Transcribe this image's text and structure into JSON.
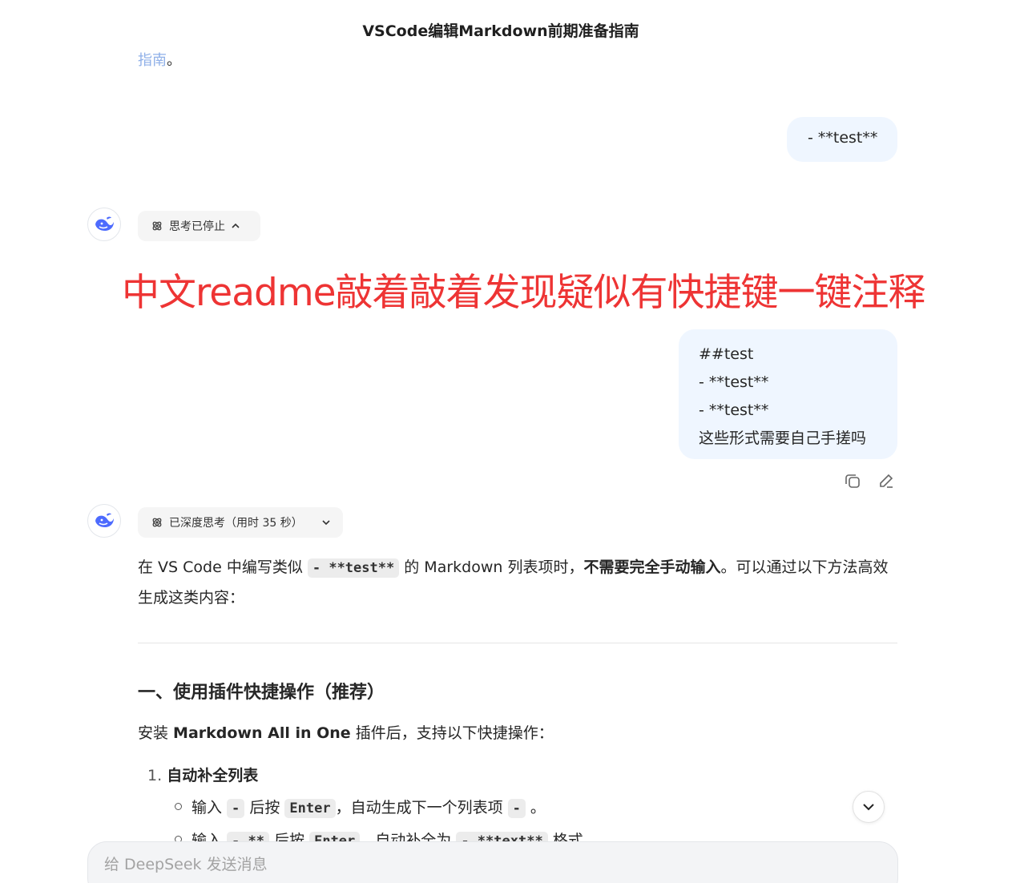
{
  "header": {
    "title": "VSCode编辑Markdown前期准备指南"
  },
  "prev_answer_tail": {
    "link_text": "指南",
    "suffix": "。"
  },
  "messages": {
    "user1": {
      "text": "- **test**"
    },
    "ai1": {
      "thinking_label": "思考已停止"
    },
    "overlay_annotation": "中文readme敲着敲着发现疑似有快捷键一键注释",
    "user2": {
      "lines": [
        "##test",
        "- **test**",
        "- **test**",
        "这些形式需要自己手搓吗"
      ]
    },
    "ai2": {
      "thinking_label": "已深度思考（用时 35 秒）",
      "para1": {
        "t1": "在 VS Code 中编写类似 ",
        "code1": "- **test**",
        "t2": " 的 Markdown 列表项时，",
        "bold": "不需要完全手动输入",
        "t3": "。可以通过以下方法高效生成这类内容："
      },
      "section1": {
        "heading": "一、使用插件快捷操作（推荐）",
        "intro_t1": "安装 ",
        "intro_bold": "Markdown All in One",
        "intro_t2": " 插件后，支持以下快捷操作：",
        "item1": {
          "num": "1.",
          "title": "自动补全列表",
          "bullets": [
            {
              "t1": "输入 ",
              "c1": "-",
              "t2": " 后按 ",
              "c2": "Enter",
              "t3": "，自动生成下一个列表项 ",
              "c3": "-",
              "t4": " 。"
            },
            {
              "t1": "输入 ",
              "c1": "- **",
              "t2": " 后按 ",
              "c2": "Enter",
              "t3": "，自动补全为 ",
              "c3": "- **text**",
              "t4": " 格式"
            }
          ]
        }
      }
    }
  },
  "composer": {
    "placeholder": "给 DeepSeek 发送消息"
  },
  "icons": [
    "deepseek-avatar-icon",
    "thinking-icon",
    "chevron-up-icon",
    "chevron-down-icon",
    "copy-icon",
    "edit-icon",
    "scroll-down-icon"
  ],
  "colors": {
    "accent": "#4d6bfe",
    "user_bubble": "#eff6ff",
    "annotation": "#ee3434",
    "link": "#8fb0e8"
  }
}
